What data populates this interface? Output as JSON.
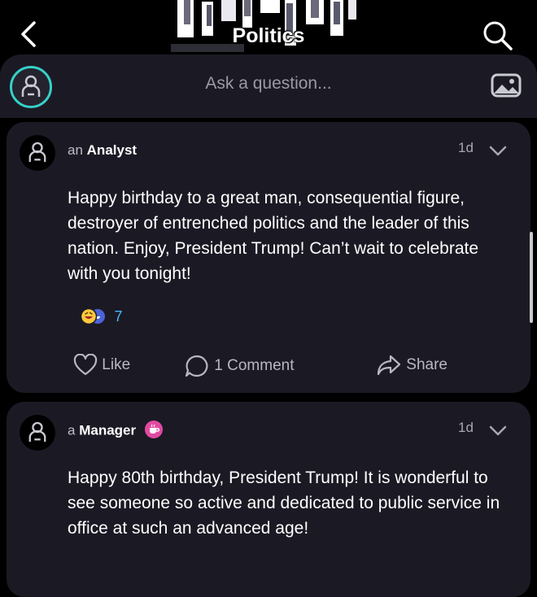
{
  "header": {
    "title": "Politics",
    "back_icon": "chevron-left-icon",
    "search_icon": "search-icon"
  },
  "ask_bar": {
    "placeholder": "Ask a question...",
    "avatar_icon": "user-icon",
    "image_icon": "image-icon",
    "accent_color": "#36d0c9"
  },
  "posts": [
    {
      "author_article": "an",
      "author_role": "Analyst",
      "time": "1d",
      "body": "Happy birthday to a great man, consequential figure, destroyer of entrenched politics and the leader of this nation. Enjoy, President Trump! Can’t wait to celebrate with you tonight!",
      "reaction_count": "7",
      "actions": {
        "like": "Like",
        "comment": "1 Comment",
        "share": "Share"
      }
    },
    {
      "author_article": "a",
      "author_role": "Manager",
      "badge_icon": "coffee-cup-icon",
      "badge_color": "#e24aa2",
      "time": "1d",
      "body": "Happy 80th birthday, President Trump! It is wonderful to see someone so active and dedicated to public service in office at such an advanced age!"
    }
  ],
  "colors": {
    "background": "#000000",
    "card": "#1b1a24",
    "reaction_count": "#48b9ff"
  }
}
